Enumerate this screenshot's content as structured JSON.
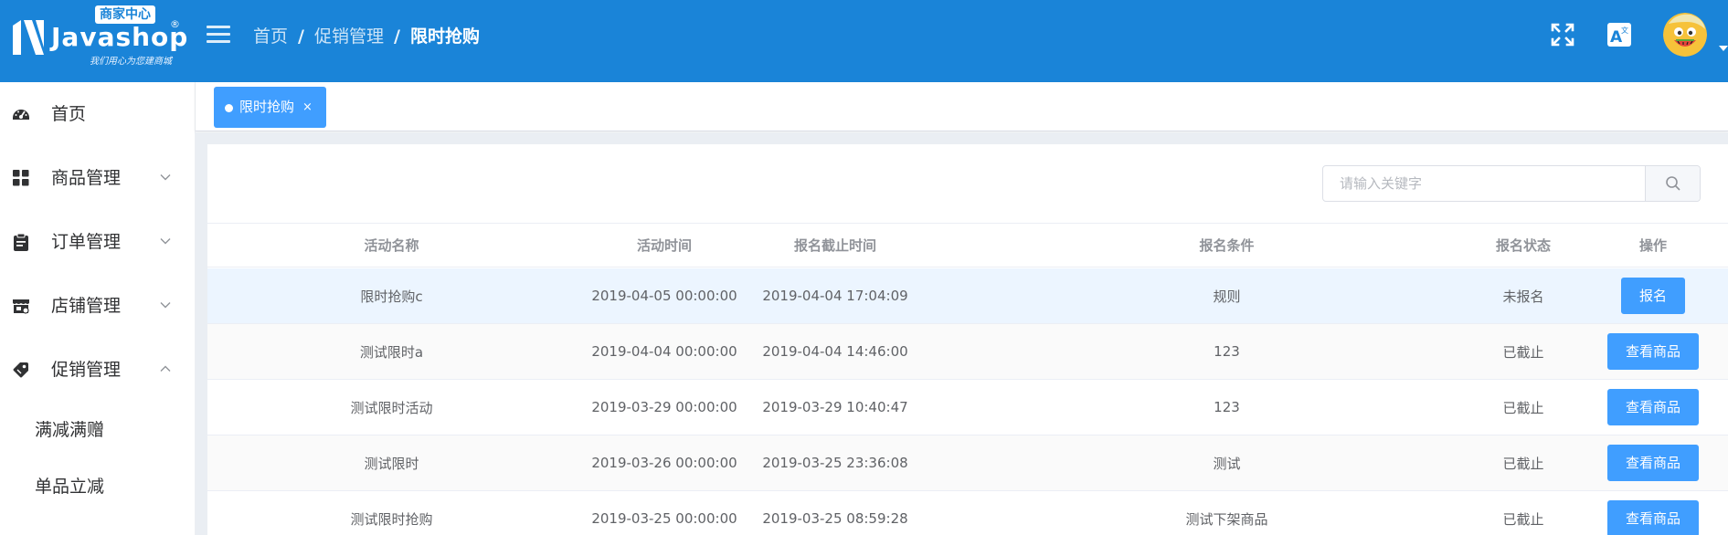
{
  "header": {
    "brand": "Javashop",
    "brand_badge": "商家中心",
    "brand_mark": "®",
    "slogan": "我们用心为您建商城",
    "breadcrumb": [
      "首页",
      "促销管理",
      "限时抢购"
    ],
    "breadcrumb_sep": "/",
    "icons": [
      "fullscreen-icon",
      "translate-icon",
      "avatar"
    ]
  },
  "sidebar": {
    "items": [
      {
        "label": "首页",
        "icon": "dashboard-icon"
      },
      {
        "label": "商品管理",
        "icon": "grid-icon",
        "chevron": "down"
      },
      {
        "label": "订单管理",
        "icon": "clipboard-icon",
        "chevron": "down"
      },
      {
        "label": "店铺管理",
        "icon": "shop-icon",
        "chevron": "down"
      },
      {
        "label": "促销管理",
        "icon": "tag-icon",
        "chevron": "up"
      }
    ],
    "sub_items": [
      {
        "label": "满减满赠"
      },
      {
        "label": "单品立减"
      }
    ]
  },
  "tabs": [
    {
      "label": "限时抢购",
      "close": "×",
      "active": true
    }
  ],
  "search": {
    "placeholder": "请输入关键字",
    "value": ""
  },
  "table": {
    "columns": [
      "活动名称",
      "活动时间",
      "报名截止时间",
      "报名条件",
      "报名状态",
      "操作"
    ],
    "rows": [
      {
        "name": "限时抢购c",
        "time": "2019-04-05 00:00:00",
        "deadline": "2019-04-04 17:04:09",
        "condition": "规则",
        "status": "未报名",
        "action": "报名"
      },
      {
        "name": "测试限时a",
        "time": "2019-04-04 00:00:00",
        "deadline": "2019-04-04 14:46:00",
        "condition": "123",
        "status": "已截止",
        "action": "查看商品"
      },
      {
        "name": "测试限时活动",
        "time": "2019-03-29 00:00:00",
        "deadline": "2019-03-29 10:40:47",
        "condition": "123",
        "status": "已截止",
        "action": "查看商品"
      },
      {
        "name": "测试限时",
        "time": "2019-03-26 00:00:00",
        "deadline": "2019-03-25 23:36:08",
        "condition": "测试",
        "status": "已截止",
        "action": "查看商品"
      },
      {
        "name": "测试限时抢购",
        "time": "2019-03-25 00:00:00",
        "deadline": "2019-03-25 08:59:28",
        "condition": "测试下架商品",
        "status": "已截止",
        "action": "查看商品"
      }
    ]
  },
  "colors": {
    "header_bg": "#1a84d8",
    "primary": "#409eff",
    "hover_row": "#ecf5ff",
    "stripe_row": "#fafafa",
    "main_bg": "#eaeef3"
  }
}
